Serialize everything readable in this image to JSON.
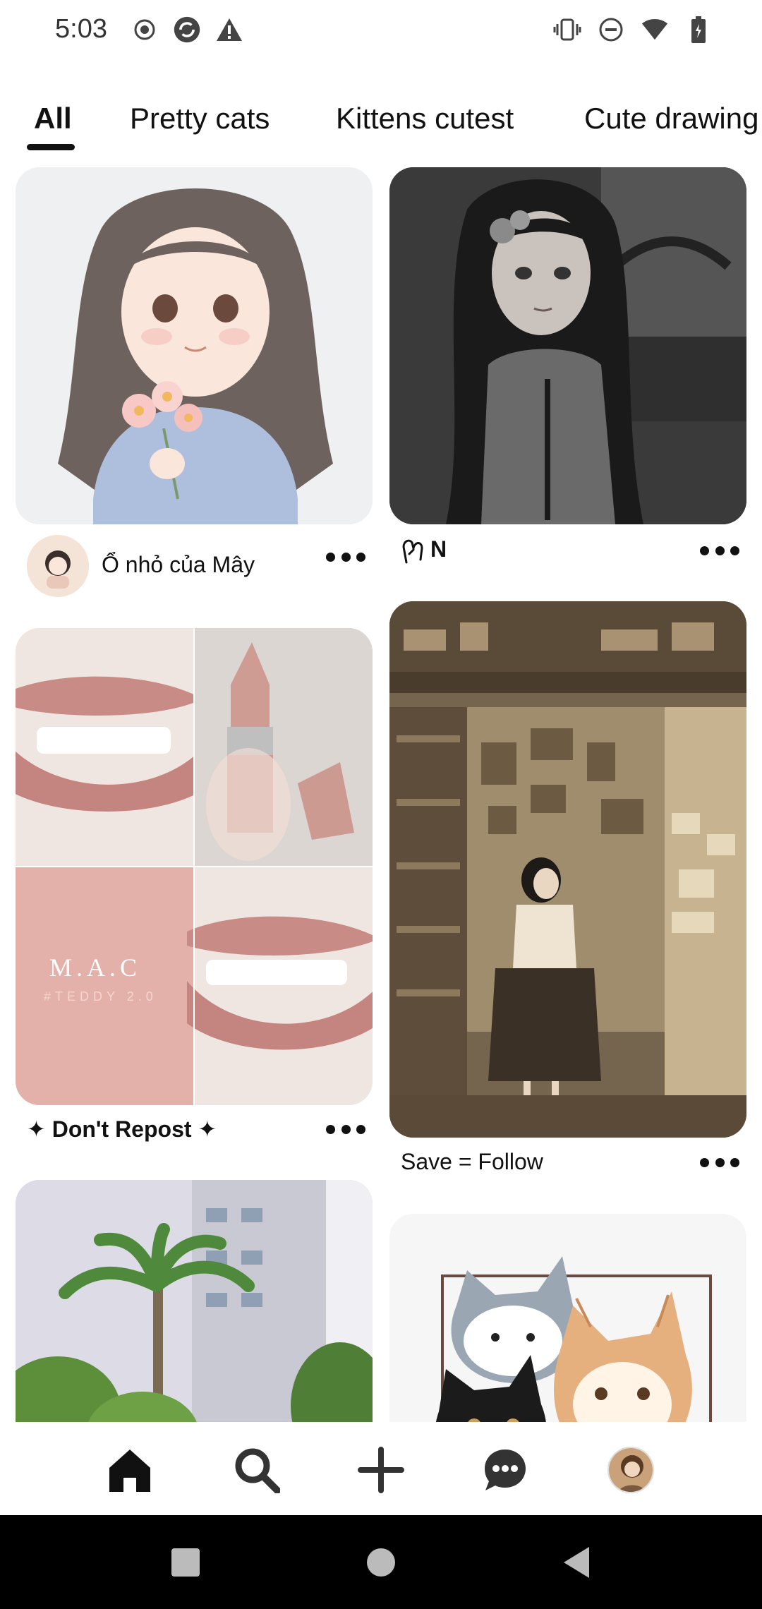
{
  "status_bar": {
    "time": "5:03",
    "left_icons": [
      "record-icon",
      "sync-icon",
      "warning-icon"
    ],
    "right_icons": [
      "vibrate-icon",
      "do-not-disturb-icon",
      "wifi-icon",
      "battery-icon"
    ]
  },
  "tabs": [
    {
      "label": "All",
      "selected": true
    },
    {
      "label": "Pretty cats",
      "selected": false
    },
    {
      "label": "Kittens cutest",
      "selected": false
    },
    {
      "label": "Cute drawing",
      "selected": false
    }
  ],
  "pins": {
    "girl_flowers": {
      "title": "Ổ nhỏ của Mây",
      "has_avatar": true
    },
    "dark_girl": {
      "title": "N",
      "icon": "hand-icon"
    },
    "lipstick": {
      "title": "✦ Don't Repost ✦",
      "overlay_title": "M.A.C",
      "overlay_sub": "#TEDDY 2.0"
    },
    "library_girl": {
      "title": "Save = Follow"
    },
    "palm_trees": {
      "title": ""
    },
    "cats": {
      "title": ""
    }
  },
  "bottom_nav": {
    "items": [
      "home-icon",
      "search-icon",
      "create-icon",
      "messages-icon",
      "profile-avatar"
    ]
  },
  "colors": {
    "text": "#111111",
    "background": "#ffffff",
    "system_nav": "#000000"
  }
}
